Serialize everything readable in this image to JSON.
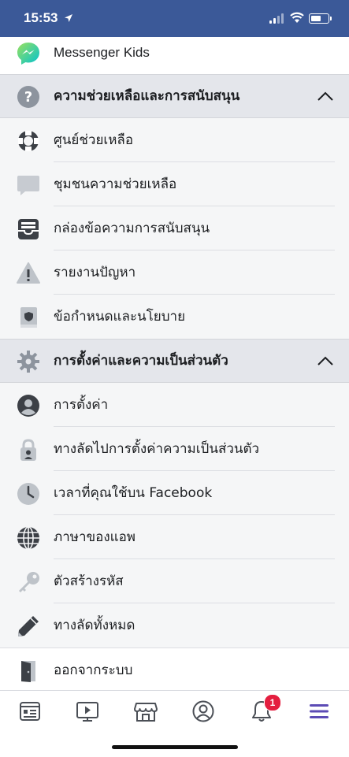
{
  "status_bar": {
    "time": "15:53"
  },
  "rows": {
    "messenger_kids": "Messenger Kids",
    "help_section": "ความช่วยเหลือและการสนับสนุน",
    "help_center": "ศูนย์ช่วยเหลือ",
    "help_community": "ชุมชนความช่วยเหลือ",
    "support_inbox": "กล่องข้อความการสนับสนุน",
    "report_problem": "รายงานปัญหา",
    "terms_policies": "ข้อกำหนดและนโยบาย",
    "settings_section": "การตั้งค่าและความเป็นส่วนตัว",
    "settings": "การตั้งค่า",
    "privacy_shortcuts": "ทางลัดไปการตั้งค่าความเป็นส่วนตัว",
    "your_time": "เวลาที่คุณใช้บน Facebook",
    "app_language": "ภาษาของแอพ",
    "code_generator": "ตัวสร้างรหัส",
    "all_shortcuts": "ทางลัดทั้งหมด",
    "log_out": "ออกจากระบบ"
  },
  "tabbar": {
    "notification_count": "1"
  },
  "colors": {
    "brand": "#3b5998",
    "menu_active": "#5c4bb5",
    "badge": "#e41e3f"
  }
}
